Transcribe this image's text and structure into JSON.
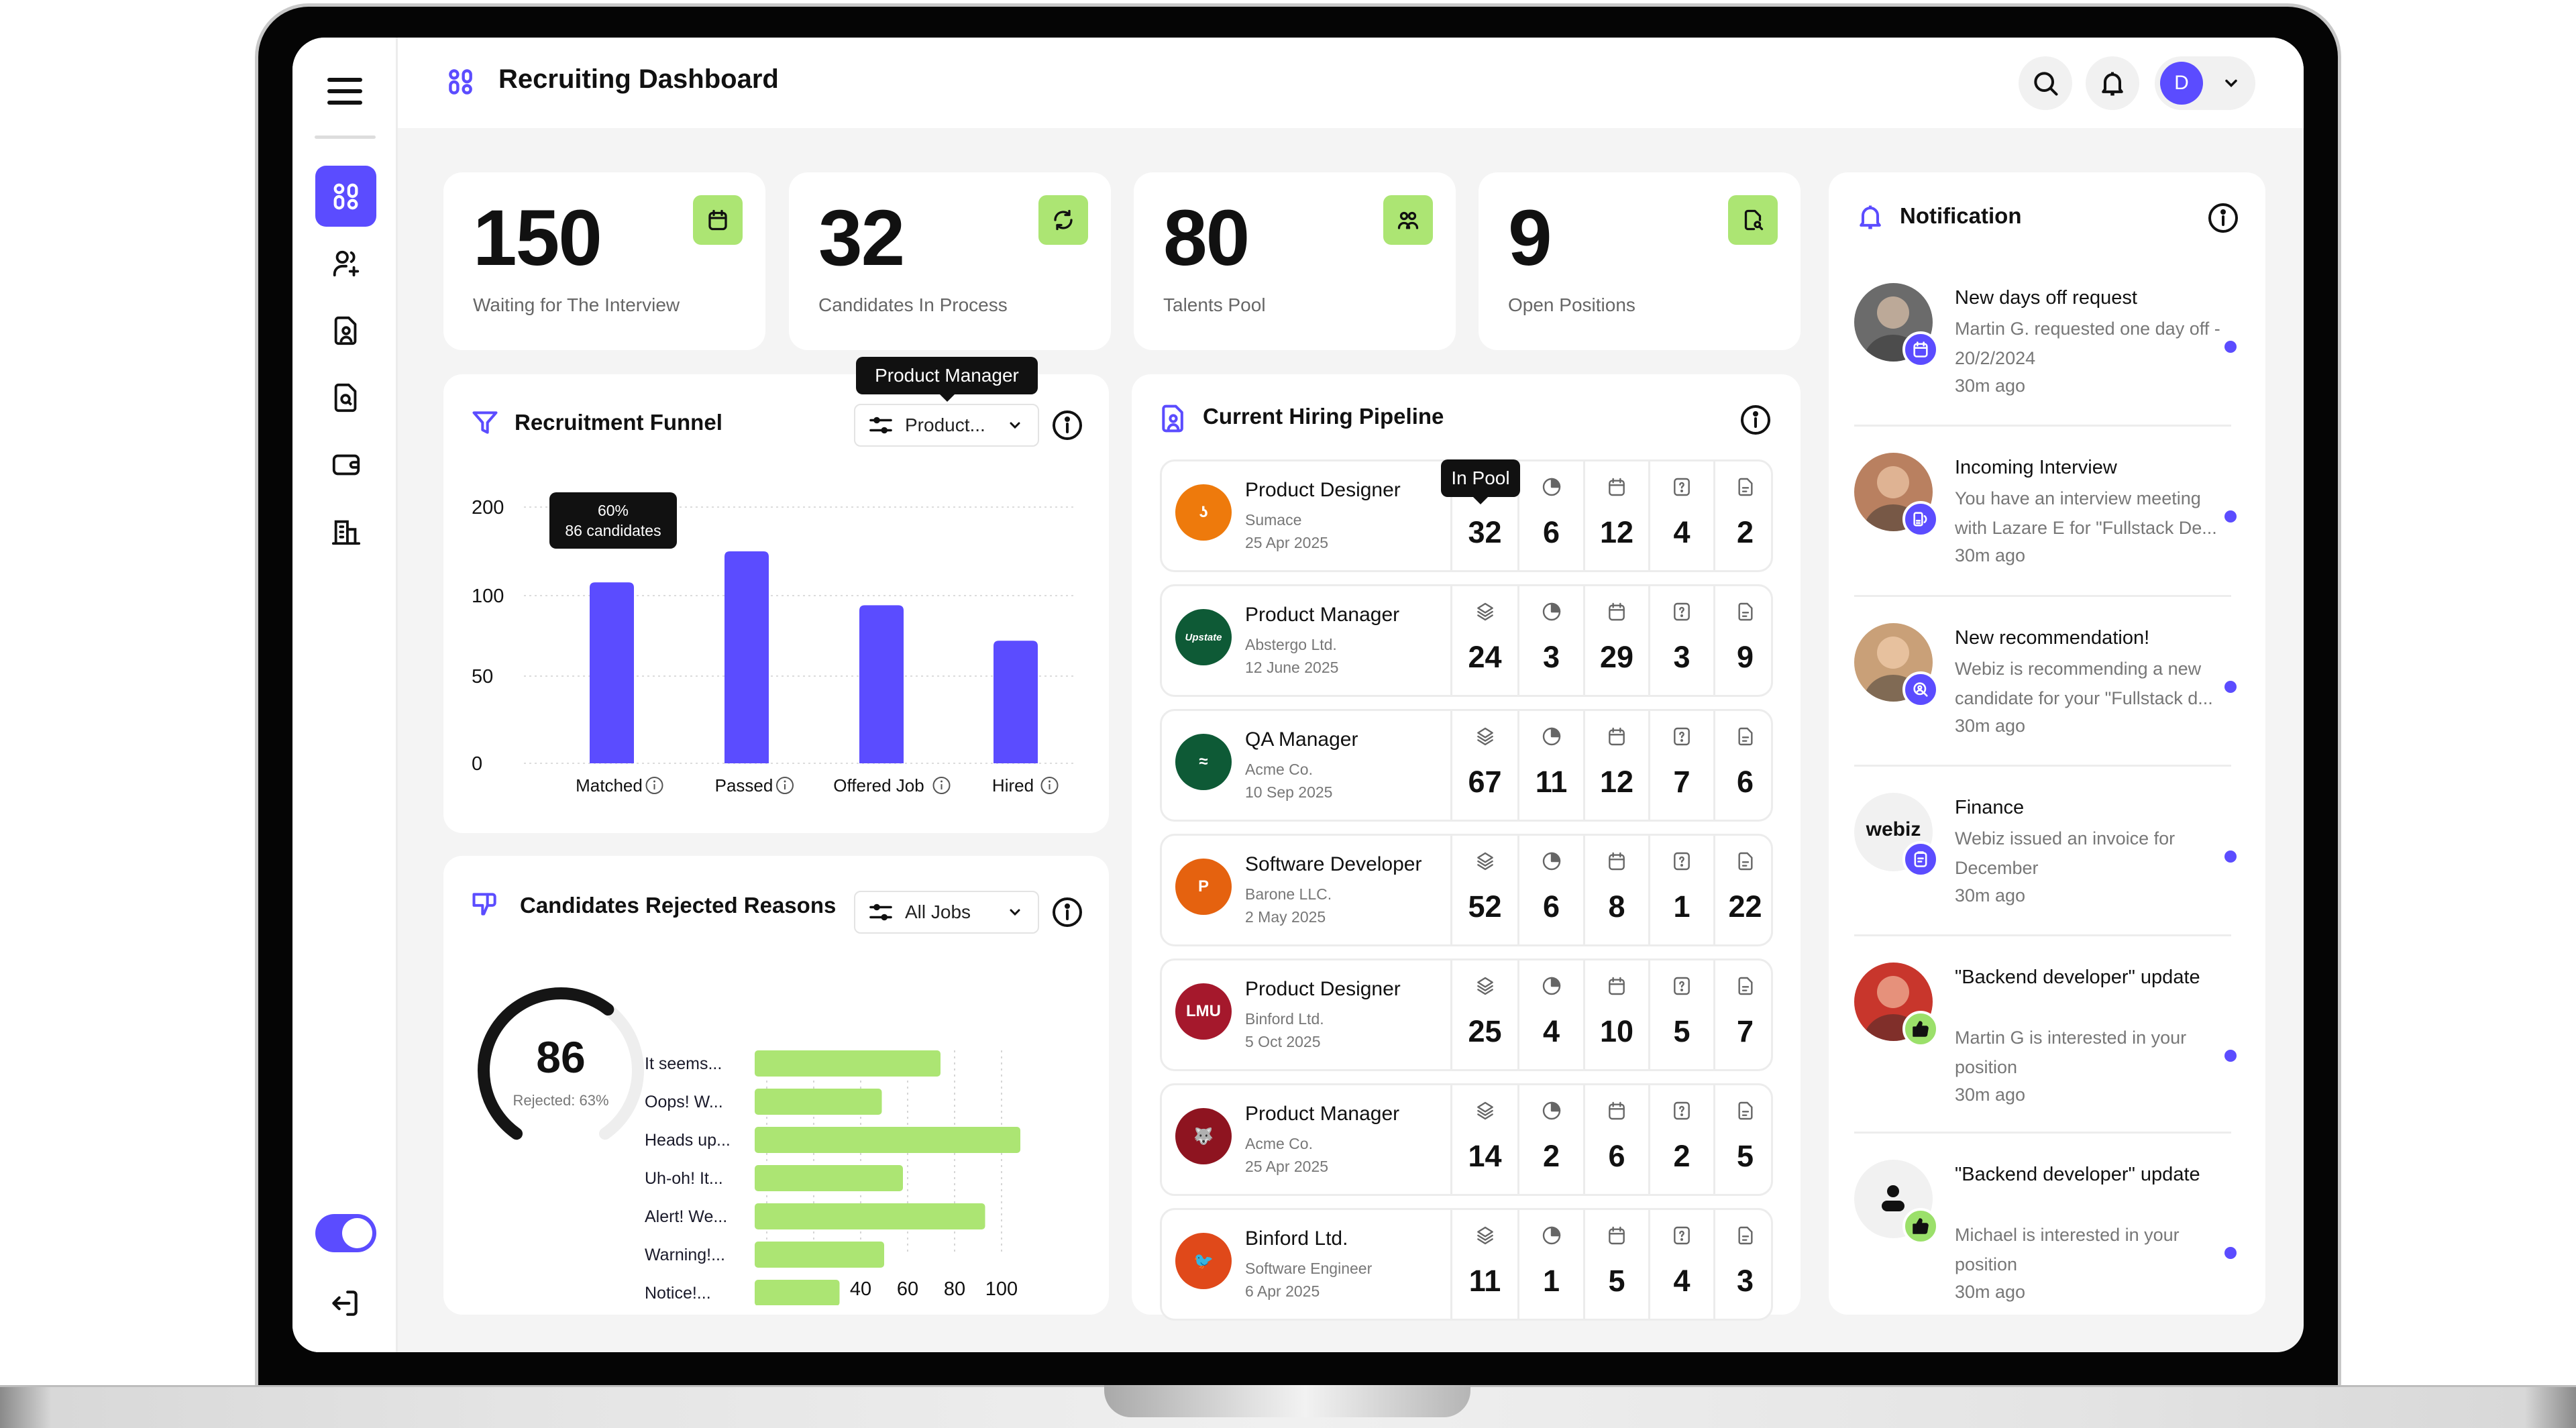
{
  "header": {
    "title": "Recruiting Dashboard",
    "user_initial": "D"
  },
  "sidebar": {
    "items": [
      {
        "name": "dashboard",
        "active": true
      },
      {
        "name": "add-user"
      },
      {
        "name": "candidate-file"
      },
      {
        "name": "file-search"
      },
      {
        "name": "wallet"
      },
      {
        "name": "building"
      }
    ],
    "toggle_on": true
  },
  "stats": [
    {
      "value": "150",
      "label": "Waiting for The Interview",
      "icon": "calendar-icon"
    },
    {
      "value": "32",
      "label": "Candidates In Process",
      "icon": "refresh-icon"
    },
    {
      "value": "80",
      "label": "Talents Pool",
      "icon": "users-group-icon"
    },
    {
      "value": "9",
      "label": "Open Positions",
      "icon": "file-search-icon"
    }
  ],
  "funnel": {
    "title": "Recruitment Funnel",
    "filter_value": "Product...",
    "filter_tooltip": "Product Manager",
    "bar_tooltip": {
      "line1": "60%",
      "line2": "86 candidates"
    }
  },
  "rejected": {
    "title": "Candidates Rejected Reasons",
    "filter_value": "All Jobs",
    "gauge_value": "86",
    "gauge_label": "Rejected: 63%",
    "gauge_fraction": 0.63
  },
  "pipeline": {
    "title": "Current Hiring Pipeline",
    "column_tooltip": "In Pool",
    "columns": [
      "In Pool",
      "Pending",
      "Scheduled",
      "Questions",
      "Documents"
    ],
    "rows": [
      {
        "title": "Product Designer",
        "company": "Sumace",
        "date": "25 Apr 2025",
        "logo_color": "#EE7A0C",
        "logo_text": "ʖ",
        "values": [
          "32",
          "6",
          "12",
          "4",
          "2"
        ]
      },
      {
        "title": "Product Manager",
        "company": "Abstergo Ltd.",
        "date": "12 June 2025",
        "logo_color": "#0E5A36",
        "logo_text": "Upstate",
        "values": [
          "24",
          "3",
          "29",
          "3",
          "9"
        ]
      },
      {
        "title": "QA Manager",
        "company": "Acme Co.",
        "date": "10 Sep 2025",
        "logo_color": "#0E5A36",
        "logo_text": "≈",
        "values": [
          "67",
          "11",
          "12",
          "7",
          "6"
        ]
      },
      {
        "title": "Software Developer",
        "company": "Barone LLC.",
        "date": "2 May 2025",
        "logo_color": "#E5620F",
        "logo_text": "P",
        "values": [
          "52",
          "6",
          "8",
          "1",
          "22"
        ]
      },
      {
        "title": "Product Designer",
        "company": "Binford Ltd.",
        "date": "5 Oct 2025",
        "logo_color": "#A5182C",
        "logo_text": "LMU",
        "values": [
          "25",
          "4",
          "10",
          "5",
          "7"
        ]
      },
      {
        "title": "Product Manager",
        "company": "Acme Co.",
        "date": "25 Apr 2025",
        "logo_color": "#8E1420",
        "logo_text": "🐺",
        "values": [
          "14",
          "2",
          "6",
          "2",
          "5"
        ]
      },
      {
        "title": "Binford Ltd.",
        "company": "Software Engineer",
        "date": "6 Apr 2025",
        "logo_color": "#E0491A",
        "logo_text": "🐦",
        "values": [
          "11",
          "1",
          "5",
          "4",
          "3"
        ]
      }
    ]
  },
  "notifications": {
    "title": "Notification",
    "items": [
      {
        "title": "New days off request",
        "body": "Martin G. requested one day off - 20/2/2024",
        "time": "30m ago",
        "badge": "calendar-icon",
        "badge_color": "#5B4CFF",
        "avatar_color": "#6b6b6b",
        "unread": true
      },
      {
        "title": "Incoming Interview",
        "body": "You have an interview meeting with Lazare E for \"Fullstack De...",
        "time": "30m ago",
        "badge": "interview-icon",
        "badge_color": "#5B4CFF",
        "avatar_color": "#b98060",
        "unread": true
      },
      {
        "title": "New recommendation!",
        "body": "Webiz is recommending  a new candidate for your \"Fullstack d...",
        "time": "30m ago",
        "badge": "user-search-icon",
        "badge_color": "#5B4CFF",
        "avatar_color": "#c9a078",
        "unread": true
      },
      {
        "title": "Finance",
        "body": "Webiz  issued an invoice for December",
        "time": "30m ago",
        "badge": "clipboard-icon",
        "badge_color": "#5B4CFF",
        "avatar_text": "webiz",
        "avatar_color": "#f1f1f1",
        "unread": true
      },
      {
        "title": "\"Backend developer\" update",
        "body": "Martin G  is interested in your position",
        "time": "30m ago",
        "badge": "thumbs-up-icon",
        "badge_color": "#9BE06A",
        "avatar_color": "#c8362c",
        "unread": true
      },
      {
        "title": "\"Backend developer\" update",
        "body": "Michael is interested in your position",
        "time": "30m ago",
        "badge": "thumbs-up-icon",
        "badge_color": "#9BE06A",
        "avatar_color": "#f1f1f1",
        "unread": true
      }
    ]
  },
  "colors": {
    "accent": "#5B4CFF",
    "green": "#ACE573",
    "background": "#F4F4F4"
  },
  "chart_data": [
    {
      "type": "bar",
      "title": "Recruitment Funnel",
      "categories": [
        "Matched",
        "Passed",
        "Offered Job",
        "Hired"
      ],
      "values": [
        115,
        150,
        94,
        72
      ],
      "yticks": [
        0,
        50,
        100,
        200
      ],
      "ylim": [
        0,
        200
      ],
      "grid": true,
      "annotation": "60% / 86 candidates (Matched)"
    },
    {
      "type": "bar",
      "orientation": "horizontal",
      "title": "Candidates Rejected Reasons",
      "categories": [
        "It seems...",
        "Oops! W...",
        "Heads up...",
        "Uh-oh! It...",
        "Alert! We...",
        "Warning!...",
        "Notice!..."
      ],
      "values": [
        74,
        49,
        108,
        58,
        93,
        50,
        31
      ],
      "xticks": [
        0,
        20,
        40,
        60,
        80,
        100
      ],
      "xlim": [
        0,
        108
      ],
      "grid": true
    }
  ]
}
